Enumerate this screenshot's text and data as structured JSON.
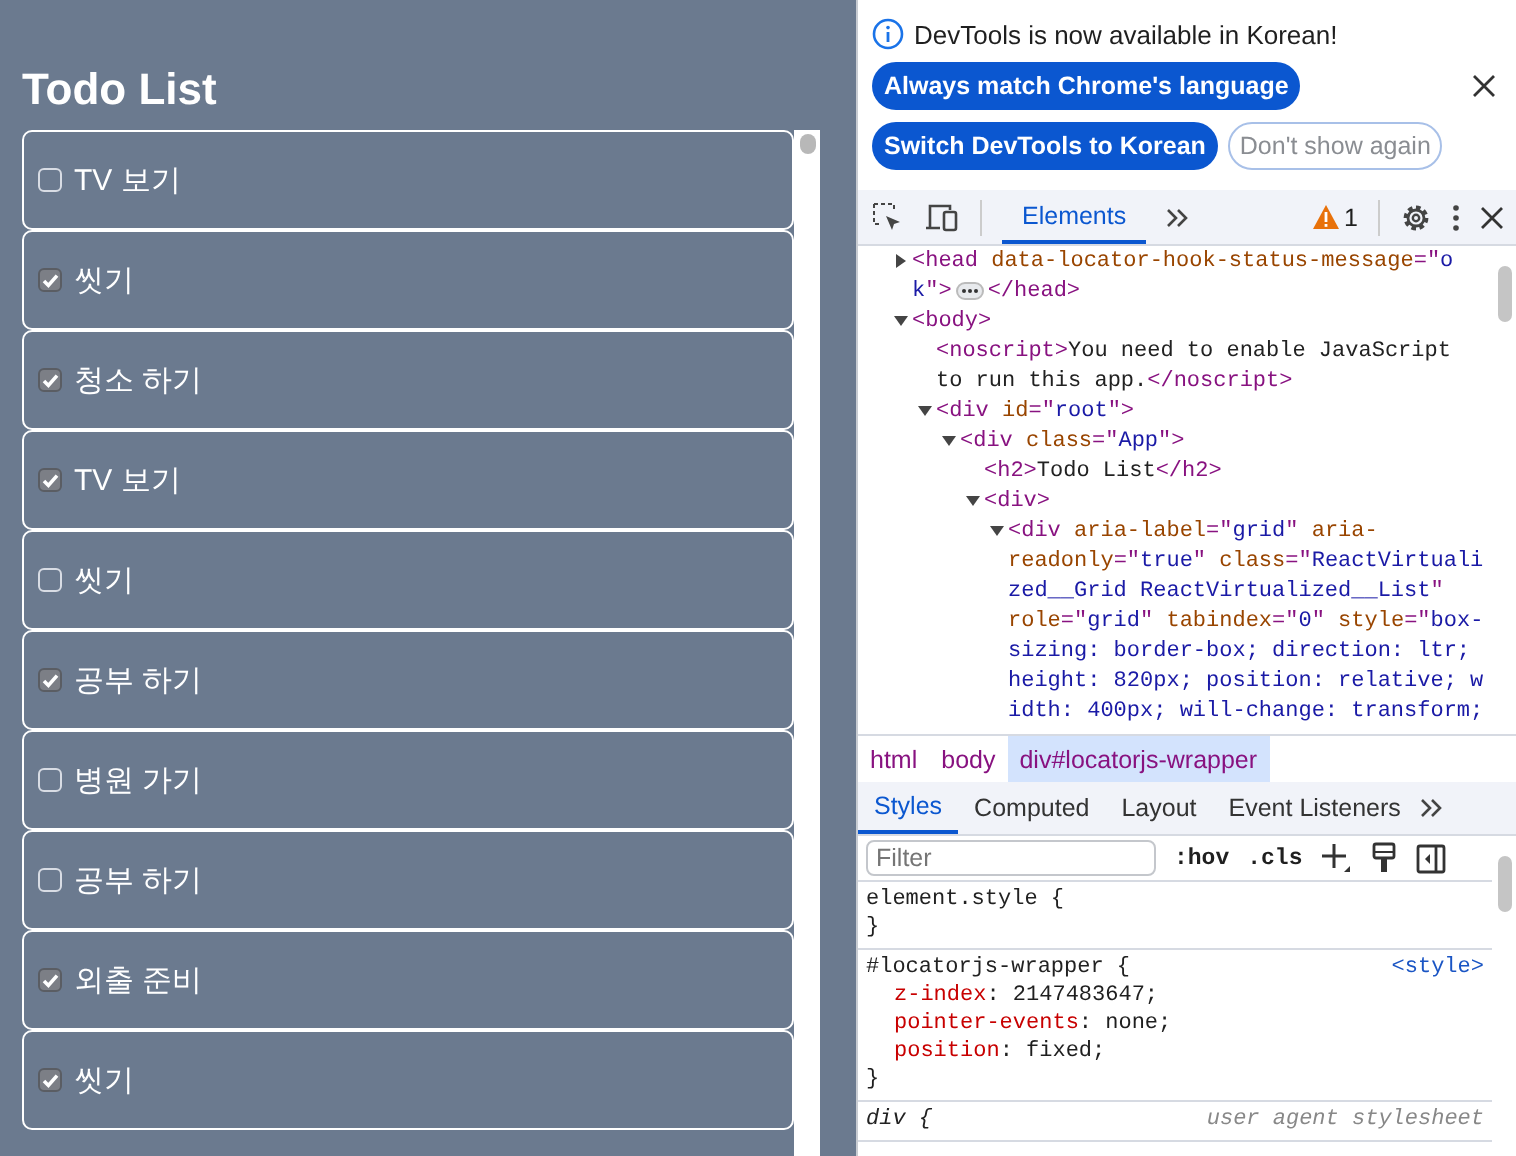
{
  "app": {
    "title": "Todo List",
    "todos": [
      {
        "text": "TV 보기",
        "checked": false
      },
      {
        "text": "씻기",
        "checked": true
      },
      {
        "text": "청소 하기",
        "checked": true
      },
      {
        "text": "TV 보기",
        "checked": true
      },
      {
        "text": "씻기",
        "checked": false
      },
      {
        "text": "공부 하기",
        "checked": true
      },
      {
        "text": "병원 가기",
        "checked": false
      },
      {
        "text": "공부 하기",
        "checked": false
      },
      {
        "text": "외출 준비",
        "checked": true
      },
      {
        "text": "씻기",
        "checked": true
      }
    ]
  },
  "devtools": {
    "banner": {
      "message": "DevTools is now available in Korean!",
      "buttons": [
        {
          "label": "Always match Chrome's language",
          "kind": "primary"
        },
        {
          "label": "Switch DevTools to Korean",
          "kind": "primary"
        },
        {
          "label": "Don't show again",
          "kind": "outlined"
        }
      ]
    },
    "toolbar": {
      "tabs": [
        {
          "label": "Elements",
          "selected": true
        }
      ],
      "warnings": "1"
    },
    "tree": [
      {
        "expanded": false,
        "lines": [
          [
            {
              "kind": "tag",
              "text": "<head "
            },
            {
              "kind": "attr",
              "text": "data-locator-hook-status-message"
            },
            {
              "kind": "tag",
              "text": "=\""
            },
            {
              "kind": "value",
              "text": "o"
            }
          ],
          [
            {
              "kind": "value",
              "text": "k"
            },
            {
              "kind": "tag",
              "text": "\">"
            },
            {
              "kind": "ellipsis"
            },
            {
              "kind": "tag",
              "text": "</head>"
            }
          ]
        ]
      },
      {
        "expanded": true,
        "lines": [
          [
            {
              "kind": "tag",
              "text": "<body>"
            }
          ]
        ],
        "children": [
          {
            "lines": [
              [
                {
                  "kind": "tag",
                  "text": "<noscript>"
                },
                {
                  "kind": "text",
                  "text": "You need to enable JavaScript"
                }
              ],
              [
                {
                  "kind": "text",
                  "text": "to run this app."
                },
                {
                  "kind": "tag",
                  "text": "</noscript>"
                }
              ]
            ]
          },
          {
            "expanded": true,
            "lines": [
              [
                {
                  "kind": "tag",
                  "text": "<div "
                },
                {
                  "kind": "attr",
                  "text": "id"
                },
                {
                  "kind": "tag",
                  "text": "=\""
                },
                {
                  "kind": "value",
                  "text": "root"
                },
                {
                  "kind": "tag",
                  "text": "\">"
                }
              ]
            ],
            "children": [
              {
                "expanded": true,
                "lines": [
                  [
                    {
                      "kind": "tag",
                      "text": "<div "
                    },
                    {
                      "kind": "attr",
                      "text": "class"
                    },
                    {
                      "kind": "tag",
                      "text": "=\""
                    },
                    {
                      "kind": "value",
                      "text": "App"
                    },
                    {
                      "kind": "tag",
                      "text": "\">"
                    }
                  ]
                ],
                "children": [
                  {
                    "lines": [
                      [
                        {
                          "kind": "tag",
                          "text": "<h2>"
                        },
                        {
                          "kind": "text",
                          "text": "Todo List"
                        },
                        {
                          "kind": "tag",
                          "text": "</h2>"
                        }
                      ]
                    ]
                  },
                  {
                    "expanded": true,
                    "lines": [
                      [
                        {
                          "kind": "tag",
                          "text": "<div>"
                        }
                      ]
                    ],
                    "children": [
                      {
                        "expanded": true,
                        "lines": [
                          [
                            {
                              "kind": "tag",
                              "text": "<div "
                            },
                            {
                              "kind": "attr",
                              "text": "aria-label"
                            },
                            {
                              "kind": "tag",
                              "text": "=\""
                            },
                            {
                              "kind": "value",
                              "text": "grid"
                            },
                            {
                              "kind": "tag",
                              "text": "\" "
                            },
                            {
                              "kind": "attr",
                              "text": "aria-"
                            }
                          ],
                          [
                            {
                              "kind": "attr",
                              "text": "readonly"
                            },
                            {
                              "kind": "tag",
                              "text": "=\""
                            },
                            {
                              "kind": "value",
                              "text": "true"
                            },
                            {
                              "kind": "tag",
                              "text": "\" "
                            },
                            {
                              "kind": "attr",
                              "text": "class"
                            },
                            {
                              "kind": "tag",
                              "text": "=\""
                            },
                            {
                              "kind": "value",
                              "text": "ReactVirtuali"
                            }
                          ],
                          [
                            {
                              "kind": "value",
                              "text": "zed__Grid ReactVirtualized__List"
                            },
                            {
                              "kind": "tag",
                              "text": "\""
                            }
                          ],
                          [
                            {
                              "kind": "attr",
                              "text": "role"
                            },
                            {
                              "kind": "tag",
                              "text": "=\""
                            },
                            {
                              "kind": "value",
                              "text": "grid"
                            },
                            {
                              "kind": "tag",
                              "text": "\" "
                            },
                            {
                              "kind": "attr",
                              "text": "tabindex"
                            },
                            {
                              "kind": "tag",
                              "text": "=\""
                            },
                            {
                              "kind": "value",
                              "text": "0"
                            },
                            {
                              "kind": "tag",
                              "text": "\" "
                            },
                            {
                              "kind": "attr",
                              "text": "style"
                            },
                            {
                              "kind": "tag",
                              "text": "=\""
                            },
                            {
                              "kind": "value",
                              "text": "box-"
                            }
                          ],
                          [
                            {
                              "kind": "value",
                              "text": "sizing: border-box; direction: ltr;"
                            }
                          ],
                          [
                            {
                              "kind": "value",
                              "text": "height: 820px; position: relative; w"
                            }
                          ],
                          [
                            {
                              "kind": "value",
                              "text": "idth: 400px; will-change: transform;"
                            }
                          ]
                        ]
                      }
                    ]
                  }
                ]
              }
            ]
          }
        ]
      }
    ],
    "breadcrumbs": [
      {
        "label": "html",
        "selected": false
      },
      {
        "label": "body",
        "selected": false
      },
      {
        "label": "div#locatorjs-wrapper",
        "selected": true
      }
    ],
    "styles_tabs": [
      {
        "label": "Styles",
        "selected": true
      },
      {
        "label": "Computed",
        "selected": false
      },
      {
        "label": "Layout",
        "selected": false
      },
      {
        "label": "Event Listeners",
        "selected": false
      }
    ],
    "filter": {
      "placeholder": "Filter"
    },
    "style_buttons": [
      ":hov",
      ".cls"
    ],
    "rules": [
      {
        "kind": "author",
        "selector": "element.style {",
        "close": "}"
      },
      {
        "kind": "author",
        "selector": "#locatorjs-wrapper {",
        "source": "<style>",
        "declarations": [
          {
            "property": "z-index",
            "value": ": 2147483647;"
          },
          {
            "property": "pointer-events",
            "value": ": none;"
          },
          {
            "property": "position",
            "value": ": fixed;"
          }
        ],
        "close": "}"
      },
      {
        "kind": "user-agent",
        "selector": "div {",
        "source": "user agent stylesheet"
      }
    ]
  }
}
